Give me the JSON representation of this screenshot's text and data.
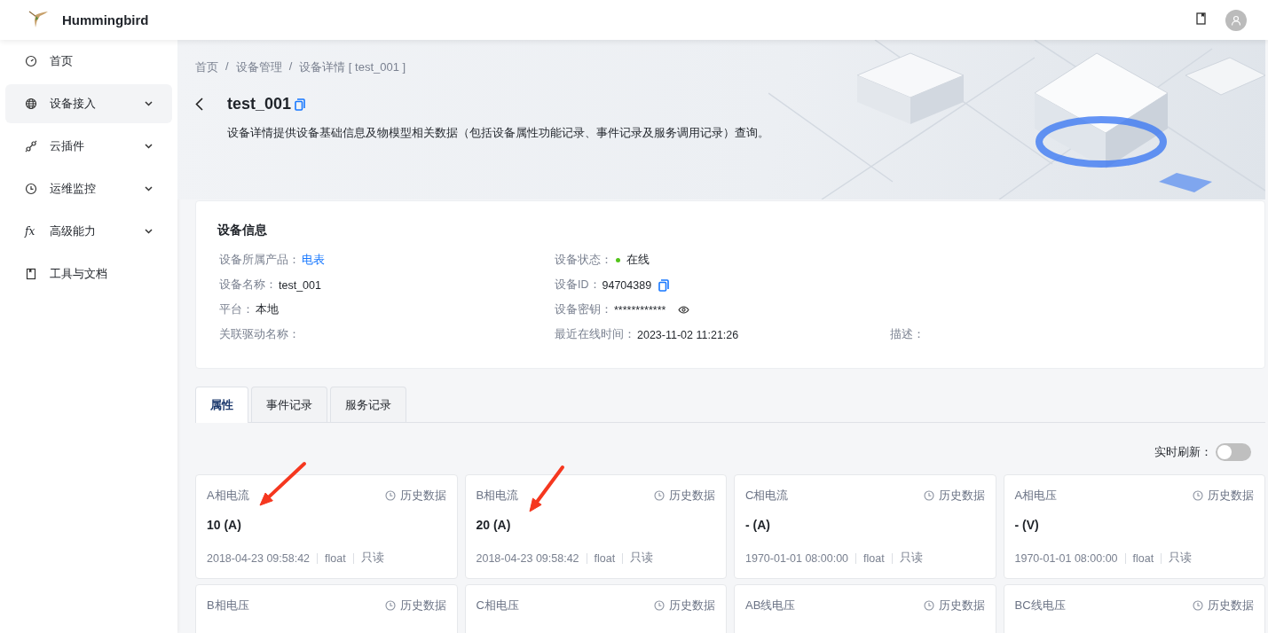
{
  "header": {
    "app_name": "Hummingbird"
  },
  "sidebar": {
    "items": [
      {
        "label": "首页",
        "expandable": false,
        "selected": false
      },
      {
        "label": "设备接入",
        "expandable": true,
        "selected": true
      },
      {
        "label": "云插件",
        "expandable": true,
        "selected": false
      },
      {
        "label": "运维监控",
        "expandable": true,
        "selected": false
      },
      {
        "label": "高级能力",
        "expandable": true,
        "selected": false,
        "glyph": "fx"
      },
      {
        "label": "工具与文档",
        "expandable": false,
        "selected": false
      }
    ]
  },
  "breadcrumb": {
    "separator": "/",
    "items": [
      "首页",
      "设备管理",
      "设备详情 [ test_001 ]"
    ]
  },
  "page": {
    "title": "test_001",
    "description": "设备详情提供设备基础信息及物模型相关数据（包括设备属性功能记录、事件记录及服务调用记录）查询。"
  },
  "device_info": {
    "title": "设备信息",
    "rows": [
      [
        {
          "label": "设备所属产品：",
          "value": "电表",
          "kind": "link"
        },
        {
          "label": "设备状态：",
          "value": "在线",
          "kind": "status",
          "color": "#52c41a"
        }
      ],
      [
        {
          "label": "设备名称：",
          "value": "test_001",
          "kind": "text"
        },
        {
          "label": "设备ID：",
          "value": "94704389",
          "kind": "copy"
        }
      ],
      [
        {
          "label": "平台：",
          "value": "本地",
          "kind": "text"
        },
        {
          "label": "设备密钥：",
          "value": "************",
          "kind": "secret"
        }
      ],
      [
        {
          "label": "关联驱动名称："
        },
        {
          "label": "最近在线时间：",
          "value": "2023-11-02 11:21:26",
          "kind": "text"
        },
        {
          "label": "描述："
        }
      ]
    ]
  },
  "tabs": [
    {
      "label": "属性",
      "selected": true
    },
    {
      "label": "事件记录",
      "selected": false
    },
    {
      "label": "服务记录",
      "selected": false
    }
  ],
  "properties": {
    "realtime_refresh": {
      "label": "实时刷新：",
      "on": false
    },
    "cards": [
      {
        "name": "A相电流",
        "history": "历史数据",
        "value": "10 (A)",
        "time": "2018-04-23 09:58:42",
        "type": "float",
        "access": "只读"
      },
      {
        "name": "B相电流",
        "history": "历史数据",
        "value": "20 (A)",
        "time": "2018-04-23 09:58:42",
        "type": "float",
        "access": "只读"
      },
      {
        "name": "C相电流",
        "history": "历史数据",
        "value": "- (A)",
        "time": "1970-01-01 08:00:00",
        "type": "float",
        "access": "只读"
      },
      {
        "name": "A相电压",
        "history": "历史数据",
        "value": "- (V)",
        "time": "1970-01-01 08:00:00",
        "type": "float",
        "access": "只读"
      },
      {
        "name": "B相电压",
        "history": "历史数据"
      },
      {
        "name": "C相电压",
        "history": "历史数据"
      },
      {
        "name": "AB线电压",
        "history": "历史数据"
      },
      {
        "name": "BC线电压",
        "history": "历史数据"
      }
    ]
  },
  "annotations": [
    {
      "kind": "arrow",
      "color": "#f5371f"
    },
    {
      "kind": "arrow",
      "color": "#f5371f"
    }
  ]
}
